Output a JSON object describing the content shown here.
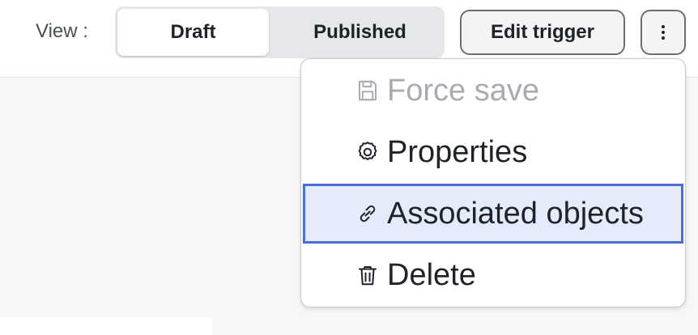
{
  "toolbar": {
    "view_label": "View :",
    "segments": {
      "draft": "Draft",
      "published": "Published",
      "selected": "Draft"
    },
    "edit_trigger_label": "Edit trigger",
    "more_icon": "kebab-vertical-icon"
  },
  "menu": {
    "items": [
      {
        "label": "Force save",
        "icon": "floppy-disk-icon",
        "disabled": true
      },
      {
        "label": "Properties",
        "icon": "gear-icon",
        "disabled": false
      },
      {
        "label": "Associated objects",
        "icon": "link-icon",
        "disabled": false,
        "highlighted": true
      },
      {
        "label": "Delete",
        "icon": "trash-icon",
        "disabled": false
      }
    ]
  },
  "colors": {
    "highlight_bg": "#e6ebfb",
    "highlight_border": "#4a6fd8",
    "disabled_text": "#a8abb0",
    "segment_track": "#e6e7ea"
  }
}
